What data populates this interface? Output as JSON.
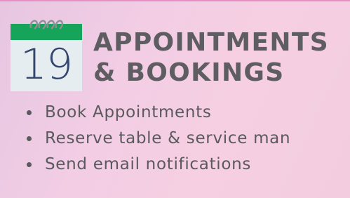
{
  "banner": {
    "calendar_icon": {
      "name": "calendar-icon",
      "day": "19",
      "colors": {
        "header": "#16a35a",
        "page": "#e6edf1",
        "number": "#34466f",
        "rings": "#8c9196"
      }
    },
    "title_line1": "APPOINTMENTS",
    "title_line2": "& BOOKINGS",
    "features": [
      "Book Appointments",
      "Reserve table & service man",
      "Send email notifications"
    ],
    "colors": {
      "text": "#5e5e62",
      "accent_rule": "#e58fc4",
      "background_start": "#e7c6e2",
      "background_end": "#f3cce0"
    }
  }
}
